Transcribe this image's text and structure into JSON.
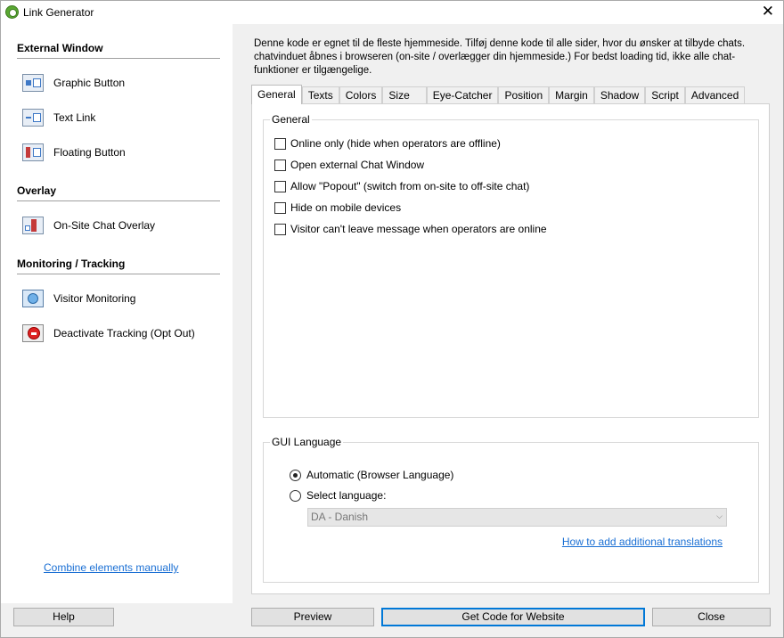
{
  "window": {
    "title": "Link Generator"
  },
  "sidebar": {
    "sections": [
      {
        "header": "External Window"
      },
      {
        "header": "Overlay"
      },
      {
        "header": "Monitoring / Tracking"
      }
    ],
    "items": [
      {
        "label": "Graphic Button"
      },
      {
        "label": "Text Link"
      },
      {
        "label": "Floating Button"
      },
      {
        "label": "On-Site Chat Overlay"
      },
      {
        "label": "Visitor Monitoring"
      },
      {
        "label": "Deactivate Tracking (Opt Out)"
      }
    ],
    "combine_link": "Combine elements manually"
  },
  "main": {
    "intro": "Denne kode er egnet til de fleste hjemmeside. Tilføj denne kode til alle sider, hvor du ønsker at tilbyde chats. chatvinduet åbnes i browseren (on-site / overlægger din hjemmeside.) For bedst loading tid, ikke alle chat-funktioner er tilgængelige.",
    "tabs": [
      "General",
      "Texts",
      "Colors",
      "Size",
      "Eye-Catcher",
      "Position",
      "Margin",
      "Shadow",
      "Script",
      "Advanced"
    ],
    "active_tab": "General",
    "general_group": {
      "label": "General",
      "options": [
        {
          "label": "Online only (hide when operators are offline)",
          "checked": false
        },
        {
          "label": "Open external Chat Window",
          "checked": false
        },
        {
          "label": "Allow \"Popout\" (switch from on-site to off-site chat)",
          "checked": false
        },
        {
          "label": "Hide on mobile devices",
          "checked": false
        },
        {
          "label": "Visitor can't leave message when operators are online",
          "checked": false
        }
      ]
    },
    "language_group": {
      "label": "GUI Language",
      "radio_automatic": "Automatic (Browser Language)",
      "radio_select": "Select language:",
      "selected_option": "automatic",
      "language_value": "DA - Danish",
      "translations_link": "How to add additional translations"
    }
  },
  "buttons": {
    "help": "Help",
    "preview": "Preview",
    "get_code": "Get Code for Website",
    "close": "Close"
  }
}
